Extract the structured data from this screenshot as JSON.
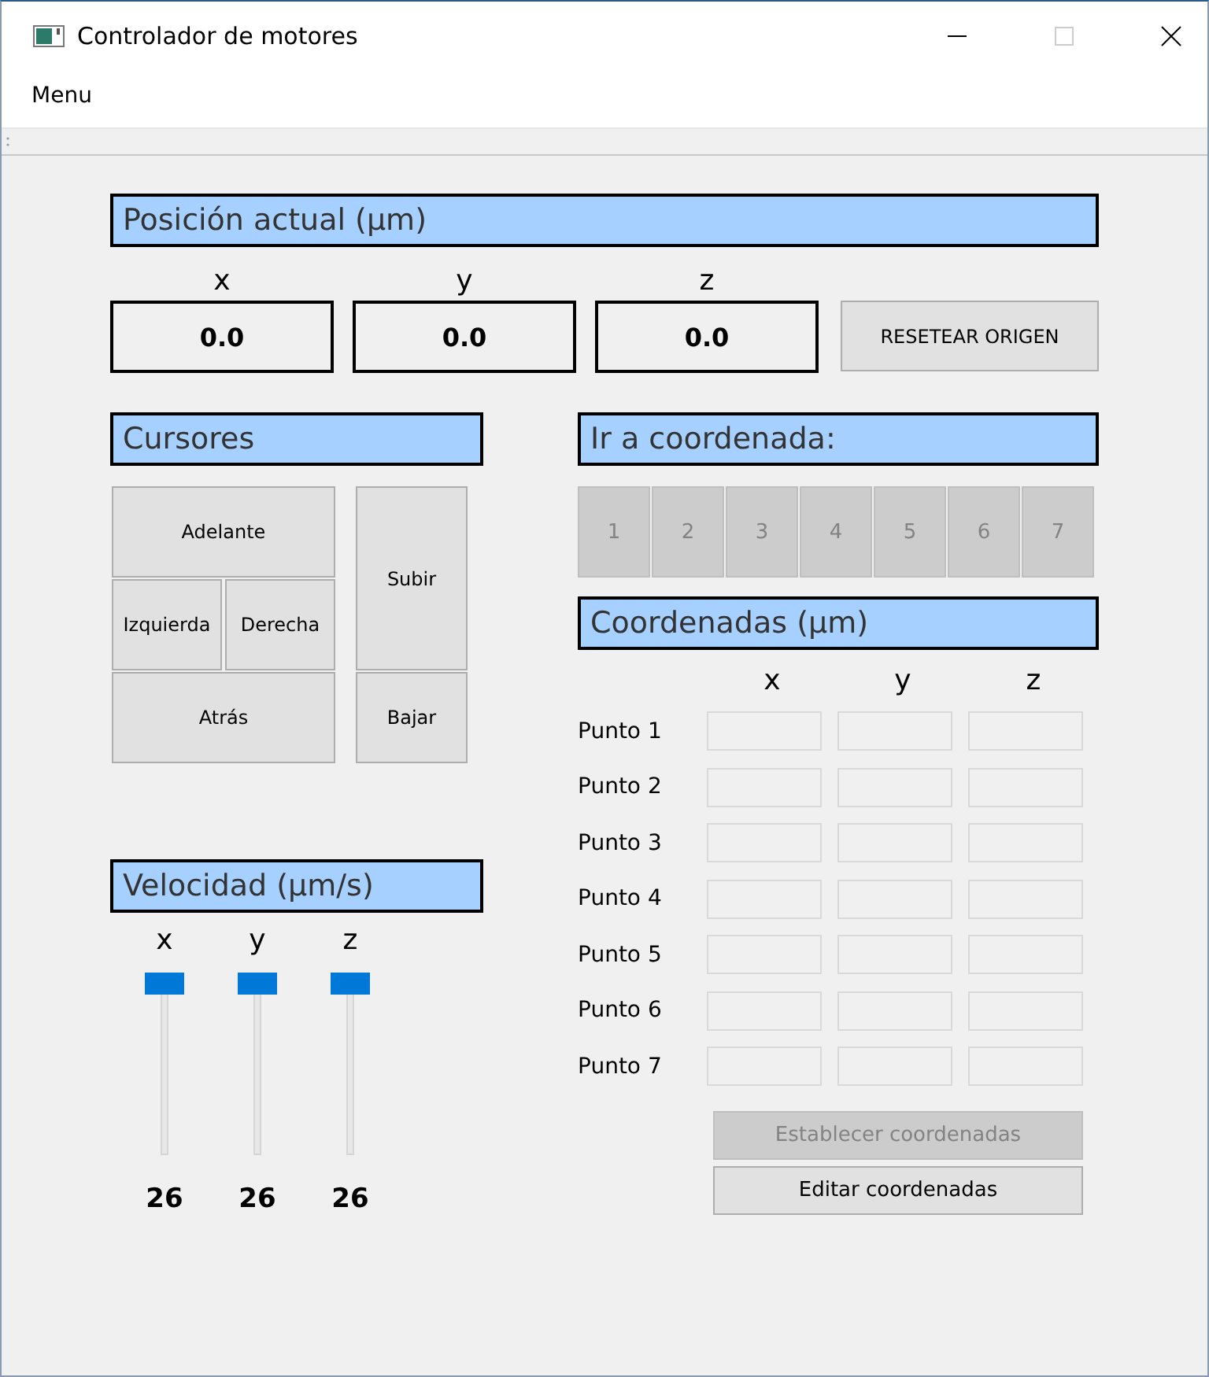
{
  "window": {
    "title": "Controlador de motores"
  },
  "menu": [
    "Menu"
  ],
  "position": {
    "title": "Posición actual (µm)",
    "axes": [
      {
        "label": "x",
        "value": "0.0"
      },
      {
        "label": "y",
        "value": "0.0"
      },
      {
        "label": "z",
        "value": "0.0"
      }
    ],
    "reset_button": "RESETEAR ORIGEN"
  },
  "cursors": {
    "title": "Cursores",
    "forward": "Adelante",
    "left": "Izquierda",
    "right": "Derecha",
    "back": "Atrás",
    "up": "Subir",
    "down": "Bajar"
  },
  "speed": {
    "title": "Velocidad (µm/s)",
    "sliders": [
      {
        "label": "x",
        "level": 1,
        "reading": "26"
      },
      {
        "label": "y",
        "level": 1,
        "reading": "26"
      },
      {
        "label": "z",
        "level": 1,
        "reading": "26"
      }
    ]
  },
  "goto": {
    "title": "Ir a coordenada:",
    "buttons": [
      {
        "label": "1",
        "disabled": true
      },
      {
        "label": "2",
        "disabled": true
      },
      {
        "label": "3",
        "disabled": true
      },
      {
        "label": "4",
        "disabled": true
      },
      {
        "label": "5",
        "disabled": true
      },
      {
        "label": "6",
        "disabled": true
      },
      {
        "label": "7",
        "disabled": true
      }
    ]
  },
  "coordinates": {
    "title": "Coordenadas (µm)",
    "columns": [
      "x",
      "y",
      "z"
    ],
    "rows": [
      "Punto 1",
      "Punto 2",
      "Punto 3",
      "Punto 4",
      "Punto 5",
      "Punto 6",
      "Punto 7"
    ],
    "buttons": [
      {
        "label": "Establecer coordenadas",
        "disabled": true
      },
      {
        "label": "Editar coordenadas",
        "disabled": false
      }
    ]
  }
}
